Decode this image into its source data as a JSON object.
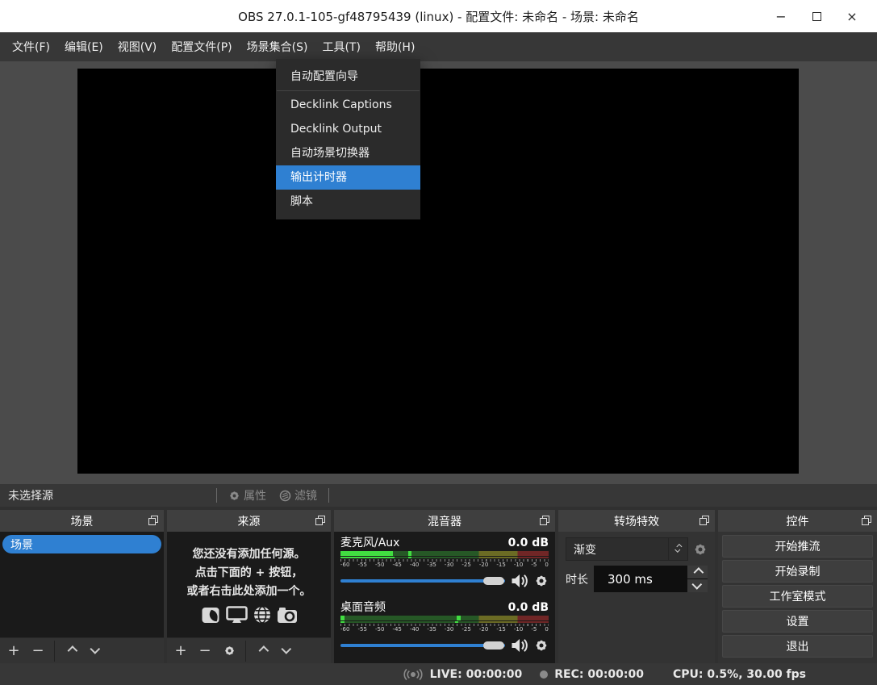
{
  "window": {
    "title": "OBS 27.0.1-105-gf48795439 (linux) - 配置文件: 未命名 - 场景: 未命名"
  },
  "menu_bar": {
    "items": [
      "文件(F)",
      "编辑(E)",
      "视图(V)",
      "配置文件(P)",
      "场景集合(S)",
      "工具(T)",
      "帮助(H)"
    ]
  },
  "tools_menu": {
    "items": [
      "自动配置向导",
      "Decklink Captions",
      "Decklink Output",
      "自动场景切换器",
      "输出计时器",
      "脚本"
    ],
    "highlighted_item": "输出计时器"
  },
  "source_toolbar": {
    "no_source": "未选择源",
    "properties": "属性",
    "filters": "滤镜"
  },
  "docks": {
    "scenes": {
      "title": "场景",
      "items": [
        "场景"
      ]
    },
    "sources": {
      "title": "来源",
      "empty_line1": "您还没有添加任何源。",
      "empty_line2": "点击下面的 + 按钮，",
      "empty_line3": "或者右击此处添加一个。"
    },
    "mixer": {
      "title": "混音器",
      "channels": [
        {
          "name": "麦克风/Aux",
          "level": "0.0 dB"
        },
        {
          "name": "桌面音频",
          "level": "0.0 dB"
        }
      ],
      "scale": [
        "-60",
        "-55",
        "-50",
        "-45",
        "-40",
        "-35",
        "-30",
        "-25",
        "-20",
        "-15",
        "-10",
        "-5",
        "0"
      ]
    },
    "transitions": {
      "title": "转场特效",
      "selected_transition": "渐变",
      "duration_label": "时长",
      "duration_value": "300 ms"
    },
    "controls": {
      "title": "控件",
      "stream": "开始推流",
      "record": "开始录制",
      "studio": "工作室模式",
      "settings": "设置",
      "exit": "退出"
    }
  },
  "status_bar": {
    "live": "LIVE: 00:00:00",
    "rec": "REC: 00:00:00",
    "stats": "CPU: 0.5%, 30.00 fps"
  },
  "colors": {
    "accent": "#2f80d2",
    "meter_bright_green": "#41dd41",
    "meter_dark_green": "#265826",
    "meter_olive": "#6b6b24",
    "meter_red": "#702626",
    "inactive_gray": "#8a8a8a"
  }
}
